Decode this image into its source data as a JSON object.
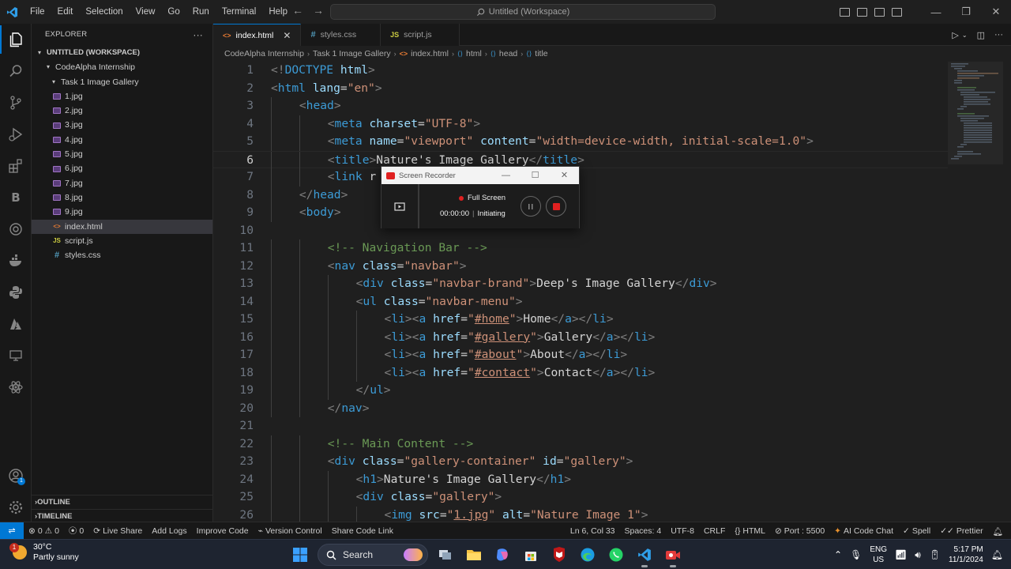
{
  "menu": [
    "File",
    "Edit",
    "Selection",
    "View",
    "Go",
    "Run",
    "Terminal",
    "Help"
  ],
  "command_center": "Untitled (Workspace)",
  "sidebar": {
    "title": "EXPLORER",
    "workspace": "UNTITLED (WORKSPACE)",
    "folder1": "CodeAlpha Internship",
    "folder2": "Task 1 Image Gallery",
    "files": [
      {
        "name": "1.jpg",
        "type": "image"
      },
      {
        "name": "2.jpg",
        "type": "image"
      },
      {
        "name": "3.jpg",
        "type": "image"
      },
      {
        "name": "4.jpg",
        "type": "image"
      },
      {
        "name": "5.jpg",
        "type": "image"
      },
      {
        "name": "6.jpg",
        "type": "image"
      },
      {
        "name": "7.jpg",
        "type": "image"
      },
      {
        "name": "8.jpg",
        "type": "image"
      },
      {
        "name": "9.jpg",
        "type": "image"
      },
      {
        "name": "index.html",
        "type": "html",
        "selected": true
      },
      {
        "name": "script.js",
        "type": "js"
      },
      {
        "name": "styles.css",
        "type": "css"
      }
    ],
    "outline": "OUTLINE",
    "timeline": "TIMELINE"
  },
  "tabs": [
    {
      "label": "index.html",
      "type": "html",
      "active": true
    },
    {
      "label": "styles.css",
      "type": "css",
      "active": false
    },
    {
      "label": "script.js",
      "type": "js",
      "active": false
    }
  ],
  "breadcrumbs": [
    "CodeAlpha Internship",
    "Task 1 Image Gallery",
    "index.html",
    "html",
    "head",
    "title"
  ],
  "code": {
    "current_line": 6,
    "lines": [
      {
        "n": "1",
        "indent": 0,
        "tokens": [
          [
            "br",
            "<!"
          ],
          [
            "tag",
            "DOCTYPE"
          ],
          [
            "txt",
            " "
          ],
          [
            "attr",
            "html"
          ],
          [
            "br",
            ">"
          ]
        ]
      },
      {
        "n": "2",
        "indent": 0,
        "tokens": [
          [
            "br",
            "<"
          ],
          [
            "tag",
            "html"
          ],
          [
            "txt",
            " "
          ],
          [
            "attr",
            "lang"
          ],
          [
            "txt",
            "="
          ],
          [
            "str",
            "\"en\""
          ],
          [
            "br",
            ">"
          ]
        ]
      },
      {
        "n": "3",
        "indent": 1,
        "tokens": [
          [
            "br",
            "<"
          ],
          [
            "tag",
            "head"
          ],
          [
            "br",
            ">"
          ]
        ]
      },
      {
        "n": "4",
        "indent": 2,
        "tokens": [
          [
            "br",
            "<"
          ],
          [
            "tag",
            "meta"
          ],
          [
            "txt",
            " "
          ],
          [
            "attr",
            "charset"
          ],
          [
            "txt",
            "="
          ],
          [
            "str",
            "\"UTF-8\""
          ],
          [
            "br",
            ">"
          ]
        ]
      },
      {
        "n": "5",
        "indent": 2,
        "tokens": [
          [
            "br",
            "<"
          ],
          [
            "tag",
            "meta"
          ],
          [
            "txt",
            " "
          ],
          [
            "attr",
            "name"
          ],
          [
            "txt",
            "="
          ],
          [
            "str",
            "\"viewport\""
          ],
          [
            "txt",
            " "
          ],
          [
            "attr",
            "content"
          ],
          [
            "txt",
            "="
          ],
          [
            "str",
            "\"width=device-width, initial-scale=1.0\""
          ],
          [
            "br",
            ">"
          ]
        ]
      },
      {
        "n": "6",
        "indent": 2,
        "tokens": [
          [
            "br",
            "<"
          ],
          [
            "tag",
            "title"
          ],
          [
            "br",
            ">"
          ],
          [
            "txt",
            "Nature's Image Gallery"
          ],
          [
            "br",
            "</"
          ],
          [
            "tag",
            "title"
          ],
          [
            "br",
            ">"
          ]
        ]
      },
      {
        "n": "7",
        "indent": 2,
        "tokens": [
          [
            "br",
            "<"
          ],
          [
            "tag",
            "link"
          ],
          [
            "txt",
            " r"
          ],
          [
            "txt",
            "                  "
          ],
          [
            "str",
            ".css\""
          ],
          [
            "br",
            ">"
          ]
        ]
      },
      {
        "n": "8",
        "indent": 1,
        "tokens": [
          [
            "br",
            "</"
          ],
          [
            "tag",
            "head"
          ],
          [
            "br",
            ">"
          ]
        ]
      },
      {
        "n": "9",
        "indent": 1,
        "tokens": [
          [
            "br",
            "<"
          ],
          [
            "tag",
            "body"
          ],
          [
            "br",
            ">"
          ]
        ]
      },
      {
        "n": "10",
        "indent": 0,
        "tokens": []
      },
      {
        "n": "11",
        "indent": 2,
        "tokens": [
          [
            "com",
            "<!-- Navigation Bar -->"
          ]
        ]
      },
      {
        "n": "12",
        "indent": 2,
        "tokens": [
          [
            "br",
            "<"
          ],
          [
            "tag",
            "nav"
          ],
          [
            "txt",
            " "
          ],
          [
            "attr",
            "class"
          ],
          [
            "txt",
            "="
          ],
          [
            "str",
            "\"navbar\""
          ],
          [
            "br",
            ">"
          ]
        ]
      },
      {
        "n": "13",
        "indent": 3,
        "tokens": [
          [
            "br",
            "<"
          ],
          [
            "tag",
            "div"
          ],
          [
            "txt",
            " "
          ],
          [
            "attr",
            "class"
          ],
          [
            "txt",
            "="
          ],
          [
            "str",
            "\"navbar-brand\""
          ],
          [
            "br",
            ">"
          ],
          [
            "txt",
            "Deep's Image Gallery"
          ],
          [
            "br",
            "</"
          ],
          [
            "tag",
            "div"
          ],
          [
            "br",
            ">"
          ]
        ]
      },
      {
        "n": "14",
        "indent": 3,
        "tokens": [
          [
            "br",
            "<"
          ],
          [
            "tag",
            "ul"
          ],
          [
            "txt",
            " "
          ],
          [
            "attr",
            "class"
          ],
          [
            "txt",
            "="
          ],
          [
            "str",
            "\"navbar-menu\""
          ],
          [
            "br",
            ">"
          ]
        ]
      },
      {
        "n": "15",
        "indent": 4,
        "tokens": [
          [
            "br",
            "<"
          ],
          [
            "tag",
            "li"
          ],
          [
            "br",
            "><"
          ],
          [
            "tag",
            "a"
          ],
          [
            "txt",
            " "
          ],
          [
            "attr",
            "href"
          ],
          [
            "txt",
            "="
          ],
          [
            "str",
            "\""
          ],
          [
            "strul",
            "#home"
          ],
          [
            "str",
            "\""
          ],
          [
            "br",
            ">"
          ],
          [
            "txt",
            "Home"
          ],
          [
            "br",
            "</"
          ],
          [
            "tag",
            "a"
          ],
          [
            "br",
            "></"
          ],
          [
            "tag",
            "li"
          ],
          [
            "br",
            ">"
          ]
        ]
      },
      {
        "n": "16",
        "indent": 4,
        "tokens": [
          [
            "br",
            "<"
          ],
          [
            "tag",
            "li"
          ],
          [
            "br",
            "><"
          ],
          [
            "tag",
            "a"
          ],
          [
            "txt",
            " "
          ],
          [
            "attr",
            "href"
          ],
          [
            "txt",
            "="
          ],
          [
            "str",
            "\""
          ],
          [
            "strul",
            "#gallery"
          ],
          [
            "str",
            "\""
          ],
          [
            "br",
            ">"
          ],
          [
            "txt",
            "Gallery"
          ],
          [
            "br",
            "</"
          ],
          [
            "tag",
            "a"
          ],
          [
            "br",
            "></"
          ],
          [
            "tag",
            "li"
          ],
          [
            "br",
            ">"
          ]
        ]
      },
      {
        "n": "17",
        "indent": 4,
        "tokens": [
          [
            "br",
            "<"
          ],
          [
            "tag",
            "li"
          ],
          [
            "br",
            "><"
          ],
          [
            "tag",
            "a"
          ],
          [
            "txt",
            " "
          ],
          [
            "attr",
            "href"
          ],
          [
            "txt",
            "="
          ],
          [
            "str",
            "\""
          ],
          [
            "strul",
            "#about"
          ],
          [
            "str",
            "\""
          ],
          [
            "br",
            ">"
          ],
          [
            "txt",
            "About"
          ],
          [
            "br",
            "</"
          ],
          [
            "tag",
            "a"
          ],
          [
            "br",
            "></"
          ],
          [
            "tag",
            "li"
          ],
          [
            "br",
            ">"
          ]
        ]
      },
      {
        "n": "18",
        "indent": 4,
        "tokens": [
          [
            "br",
            "<"
          ],
          [
            "tag",
            "li"
          ],
          [
            "br",
            "><"
          ],
          [
            "tag",
            "a"
          ],
          [
            "txt",
            " "
          ],
          [
            "attr",
            "href"
          ],
          [
            "txt",
            "="
          ],
          [
            "str",
            "\""
          ],
          [
            "strul",
            "#contact"
          ],
          [
            "str",
            "\""
          ],
          [
            "br",
            ">"
          ],
          [
            "txt",
            "Contact"
          ],
          [
            "br",
            "</"
          ],
          [
            "tag",
            "a"
          ],
          [
            "br",
            "></"
          ],
          [
            "tag",
            "li"
          ],
          [
            "br",
            ">"
          ]
        ]
      },
      {
        "n": "19",
        "indent": 3,
        "tokens": [
          [
            "br",
            "</"
          ],
          [
            "tag",
            "ul"
          ],
          [
            "br",
            ">"
          ]
        ]
      },
      {
        "n": "20",
        "indent": 2,
        "tokens": [
          [
            "br",
            "</"
          ],
          [
            "tag",
            "nav"
          ],
          [
            "br",
            ">"
          ]
        ]
      },
      {
        "n": "21",
        "indent": 0,
        "tokens": []
      },
      {
        "n": "22",
        "indent": 2,
        "tokens": [
          [
            "com",
            "<!-- Main Content -->"
          ]
        ]
      },
      {
        "n": "23",
        "indent": 2,
        "tokens": [
          [
            "br",
            "<"
          ],
          [
            "tag",
            "div"
          ],
          [
            "txt",
            " "
          ],
          [
            "attr",
            "class"
          ],
          [
            "txt",
            "="
          ],
          [
            "str",
            "\"gallery-container\""
          ],
          [
            "txt",
            " "
          ],
          [
            "attr",
            "id"
          ],
          [
            "txt",
            "="
          ],
          [
            "str",
            "\"gallery\""
          ],
          [
            "br",
            ">"
          ]
        ]
      },
      {
        "n": "24",
        "indent": 3,
        "tokens": [
          [
            "br",
            "<"
          ],
          [
            "tag",
            "h1"
          ],
          [
            "br",
            ">"
          ],
          [
            "txt",
            "Nature's Image Gallery"
          ],
          [
            "br",
            "</"
          ],
          [
            "tag",
            "h1"
          ],
          [
            "br",
            ">"
          ]
        ]
      },
      {
        "n": "25",
        "indent": 3,
        "tokens": [
          [
            "br",
            "<"
          ],
          [
            "tag",
            "div"
          ],
          [
            "txt",
            " "
          ],
          [
            "attr",
            "class"
          ],
          [
            "txt",
            "="
          ],
          [
            "str",
            "\"gallery\""
          ],
          [
            "br",
            ">"
          ]
        ]
      },
      {
        "n": "26",
        "indent": 4,
        "tokens": [
          [
            "br",
            "<"
          ],
          [
            "tag",
            "img"
          ],
          [
            "txt",
            " "
          ],
          [
            "attr",
            "src"
          ],
          [
            "txt",
            "="
          ],
          [
            "str",
            "\""
          ],
          [
            "strul",
            "1.jpg"
          ],
          [
            "str",
            "\""
          ],
          [
            "txt",
            " "
          ],
          [
            "attr",
            "alt"
          ],
          [
            "txt",
            "="
          ],
          [
            "str",
            "\"Nature Image 1\""
          ],
          [
            "br",
            ">"
          ]
        ]
      }
    ]
  },
  "recorder": {
    "title": "Screen Recorder",
    "mode": "Full Screen",
    "time": "00:00:00",
    "status": "Initiating"
  },
  "statusbar": {
    "errors": "0",
    "warnings": "0",
    "ports": "0",
    "left_items": [
      "Live Share",
      "Add Logs",
      "Improve Code",
      "Version Control",
      "Share Code Link"
    ],
    "position": "Ln 6, Col 33",
    "spaces": "Spaces: 4",
    "encoding": "UTF-8",
    "eol": "CRLF",
    "language": "HTML",
    "port": "Port : 5500",
    "ai_chat": "AI Code Chat",
    "spell": "Spell",
    "prettier": "Prettier"
  },
  "taskbar": {
    "weather_temp": "30°C",
    "weather_desc": "Partly sunny",
    "weather_badge": "1",
    "search": "Search",
    "lang_top": "ENG",
    "lang_bottom": "US",
    "time": "5:17 PM",
    "date": "11/1/2024"
  },
  "colors": {
    "accent": "#0078d4",
    "editor_bg": "#1f1f1f",
    "sidebar_bg": "#181818",
    "record_red": "#e02020"
  }
}
